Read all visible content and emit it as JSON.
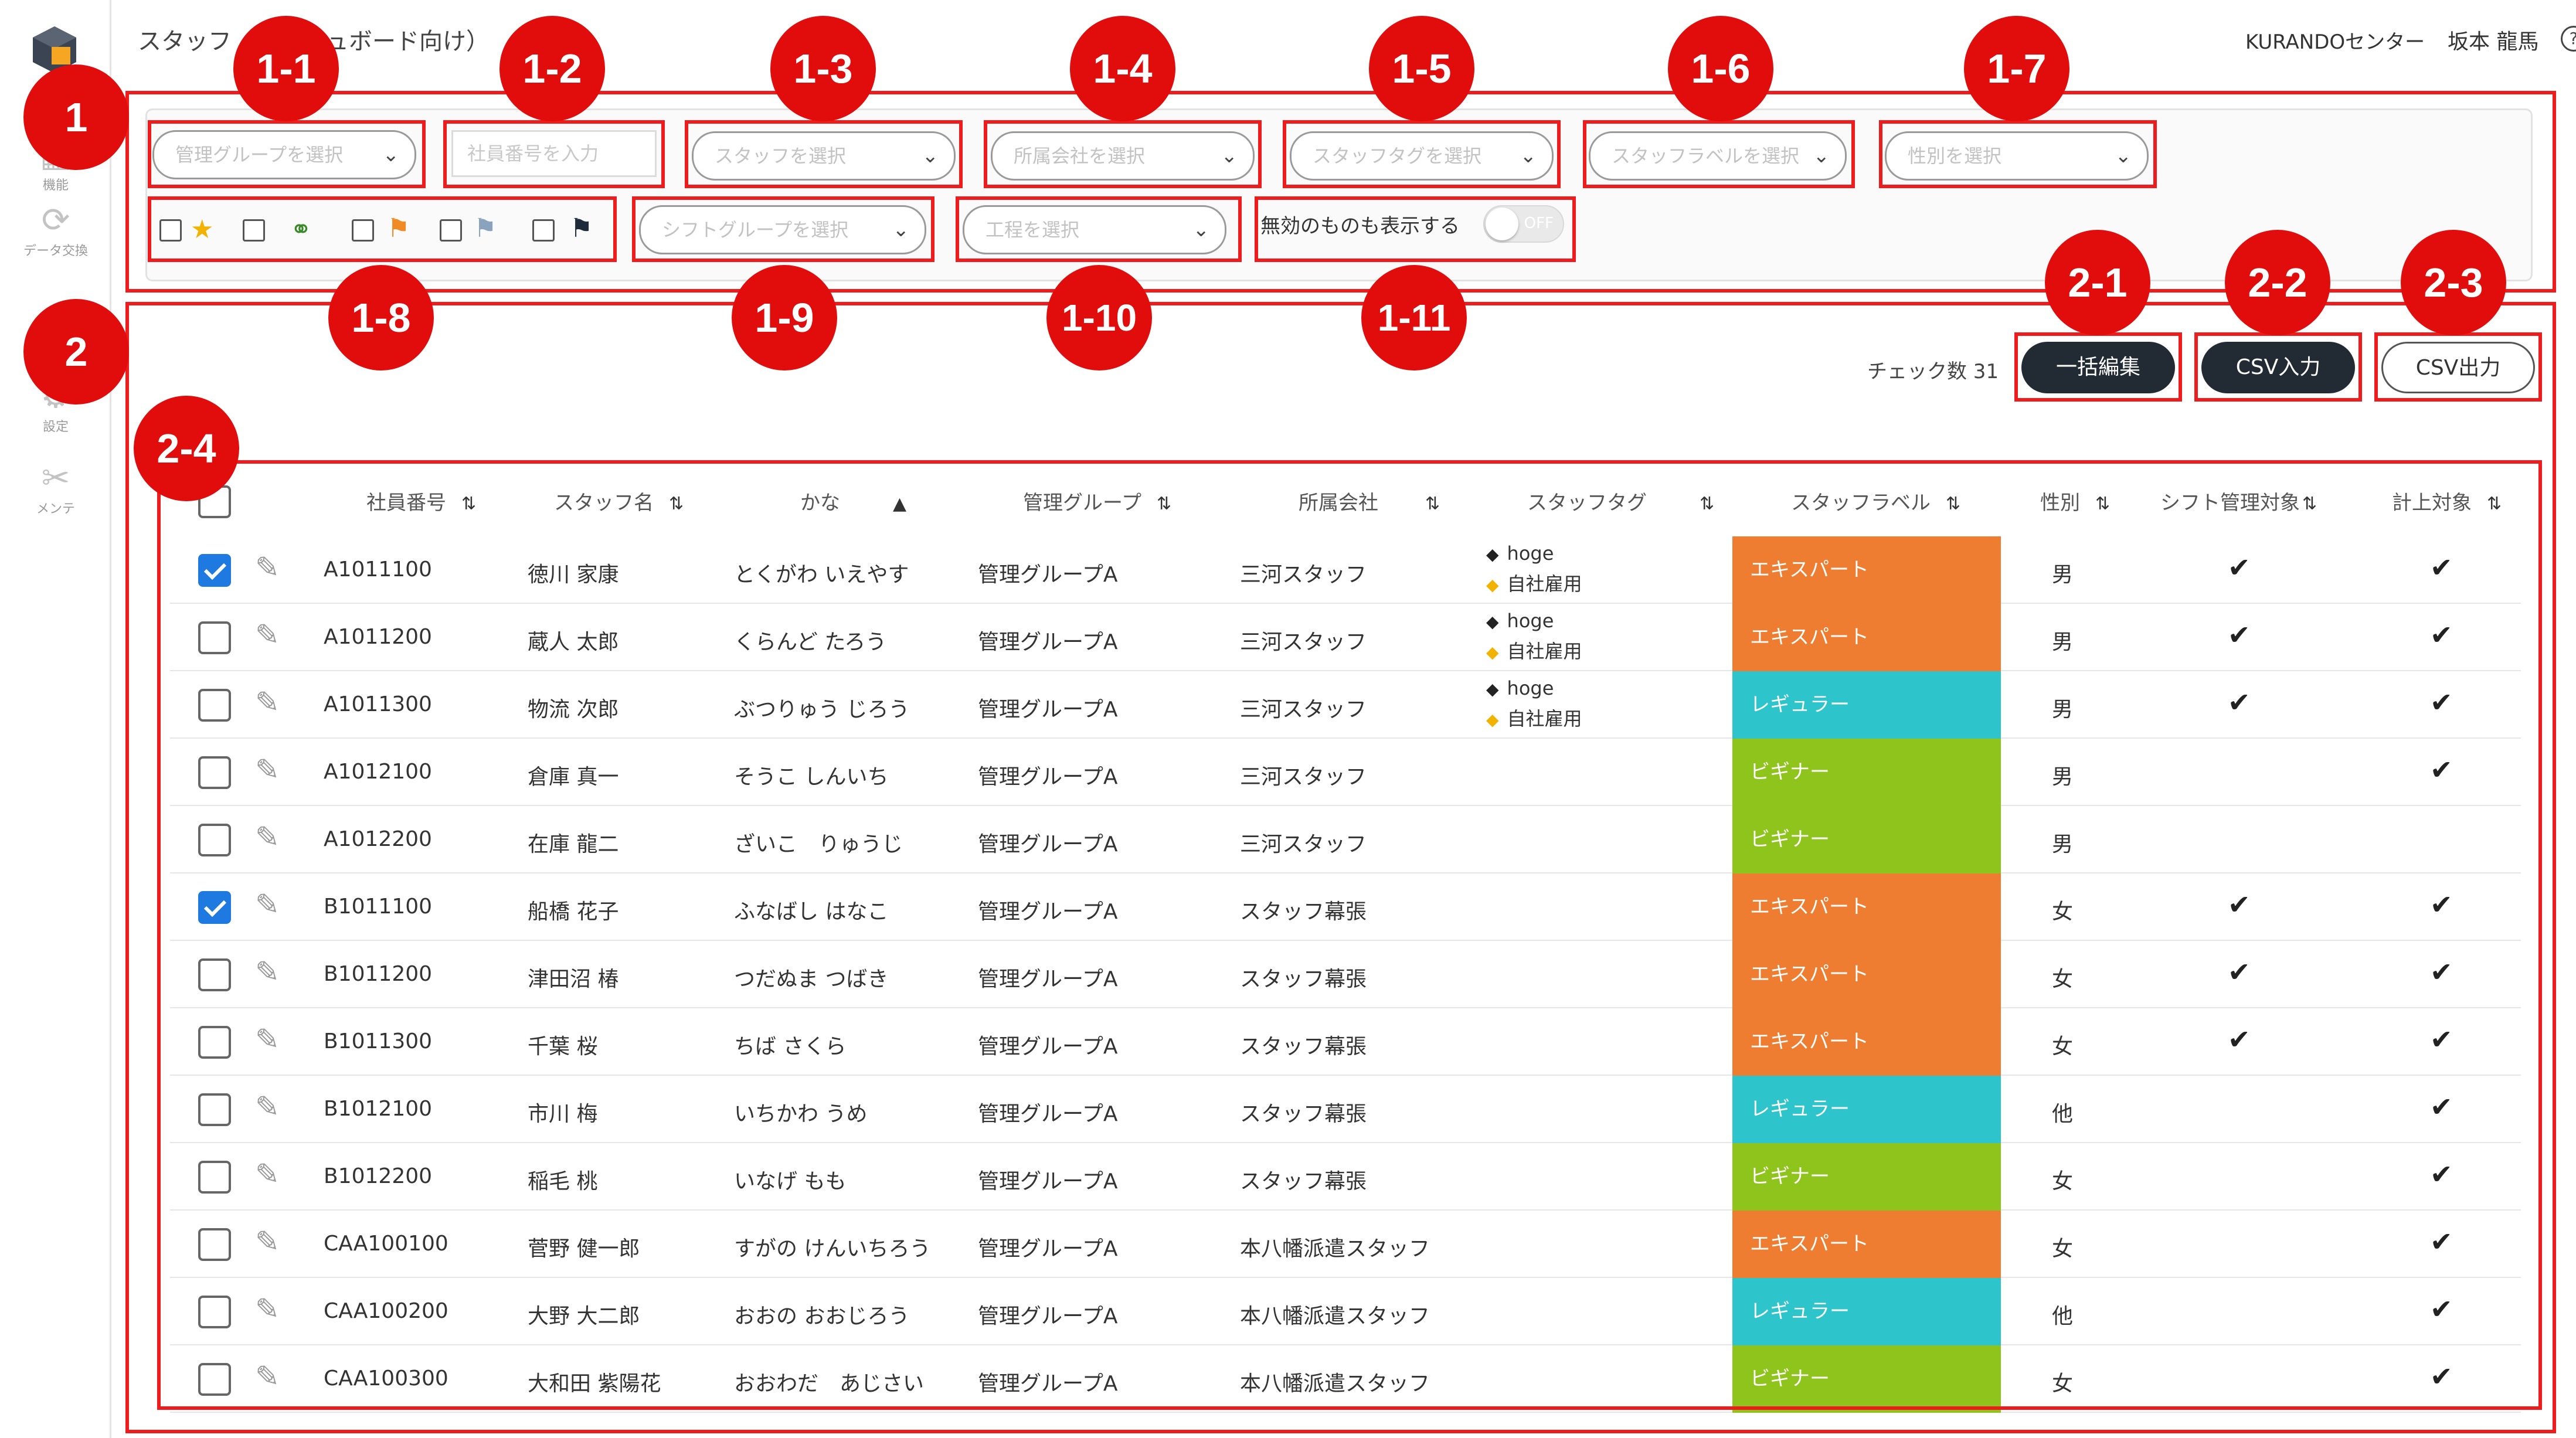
{
  "header": {
    "title": "スタッフ（ダッシュボード向け）",
    "center_name": "KURANDOセンター",
    "user_name": "坂本 龍馬",
    "help_icon": "help-circle-icon",
    "logout_icon": "logout-icon"
  },
  "sidebar": {
    "logo_icon": "cube-logo-icon",
    "items": [
      {
        "label": "機能",
        "icon": "grid-icon"
      },
      {
        "label": "データ交換",
        "icon": "sync-icon"
      },
      {
        "label": "設定",
        "icon": "gear-icon"
      },
      {
        "label": "メンテ",
        "icon": "tools-icon"
      }
    ]
  },
  "filters": {
    "management_group": "管理グループを選択",
    "employee_no": "社員番号を入力",
    "staff": "スタッフを選択",
    "company": "所属会社を選択",
    "staff_tag": "スタッフタグを選択",
    "staff_label": "スタッフラベルを選択",
    "gender": "性別を選択",
    "shift_group": "シフトグループを選択",
    "process": "工程を選択",
    "show_invalid": "無効のものも表示する",
    "toggle_state": "OFF",
    "flag_icons": [
      {
        "icon": "star-icon",
        "color": "#f2b200"
      },
      {
        "icon": "people-icon",
        "color": "#3a8a2a"
      },
      {
        "icon": "flag-icon",
        "color": "#f08a24"
      },
      {
        "icon": "flag-icon",
        "color": "#8aa3bd"
      },
      {
        "icon": "flag-icon",
        "color": "#1c2a3a"
      }
    ]
  },
  "actions": {
    "check_count": "チェック数 31",
    "bulk_edit": "一括編集",
    "csv_import": "CSV入力",
    "csv_export": "CSV出力"
  },
  "table": {
    "columns": [
      "社員番号",
      "スタッフ名",
      "かな",
      "管理グループ",
      "所属会社",
      "スタッフタグ",
      "スタッフラベル",
      "性別",
      "シフト管理対象",
      "計上対象"
    ],
    "label_colors": {
      "エキスパート": "#ee7d31",
      "レギュラー": "#2dc4cc",
      "ビギナー": "#8ec41c"
    },
    "rows": [
      {
        "checked": true,
        "id": "A1011100",
        "name": "徳川 家康",
        "kana": "とくがわ いえやす",
        "group": "管理グループA",
        "company": "三河スタッフ",
        "tags": [
          "hoge",
          "自社雇用"
        ],
        "label": "エキスパート",
        "gender": "男",
        "shift": "✔",
        "count": "✔"
      },
      {
        "checked": false,
        "id": "A1011200",
        "name": "蔵人 太郎",
        "kana": "くらんど たろう",
        "group": "管理グループA",
        "company": "三河スタッフ",
        "tags": [
          "hoge",
          "自社雇用"
        ],
        "label": "エキスパート",
        "gender": "男",
        "shift": "✔",
        "count": "✔"
      },
      {
        "checked": false,
        "id": "A1011300",
        "name": "物流 次郎",
        "kana": "ぶつりゅう じろう",
        "group": "管理グループA",
        "company": "三河スタッフ",
        "tags": [
          "hoge",
          "自社雇用"
        ],
        "label": "レギュラー",
        "gender": "男",
        "shift": "✔",
        "count": "✔"
      },
      {
        "checked": false,
        "id": "A1012100",
        "name": "倉庫 真一",
        "kana": "そうこ しんいち",
        "group": "管理グループA",
        "company": "三河スタッフ",
        "tags": [],
        "label": "ビギナー",
        "gender": "男",
        "shift": "",
        "count": "✔"
      },
      {
        "checked": false,
        "id": "A1012200",
        "name": "在庫 龍二",
        "kana": "ざいこ　りゅうじ",
        "group": "管理グループA",
        "company": "三河スタッフ",
        "tags": [],
        "label": "ビギナー",
        "gender": "男",
        "shift": "",
        "count": ""
      },
      {
        "checked": true,
        "id": "B1011100",
        "name": "船橋 花子",
        "kana": "ふなばし はなこ",
        "group": "管理グループA",
        "company": "スタッフ幕張",
        "tags": [],
        "label": "エキスパート",
        "gender": "女",
        "shift": "✔",
        "count": "✔"
      },
      {
        "checked": false,
        "id": "B1011200",
        "name": "津田沼 椿",
        "kana": "つだぬま つばき",
        "group": "管理グループA",
        "company": "スタッフ幕張",
        "tags": [],
        "label": "エキスパート",
        "gender": "女",
        "shift": "✔",
        "count": "✔"
      },
      {
        "checked": false,
        "id": "B1011300",
        "name": "千葉 桜",
        "kana": "ちば さくら",
        "group": "管理グループA",
        "company": "スタッフ幕張",
        "tags": [],
        "label": "エキスパート",
        "gender": "女",
        "shift": "✔",
        "count": "✔"
      },
      {
        "checked": false,
        "id": "B1012100",
        "name": "市川 梅",
        "kana": "いちかわ うめ",
        "group": "管理グループA",
        "company": "スタッフ幕張",
        "tags": [],
        "label": "レギュラー",
        "gender": "他",
        "shift": "",
        "count": "✔"
      },
      {
        "checked": false,
        "id": "B1012200",
        "name": "稲毛 桃",
        "kana": "いなげ もも",
        "group": "管理グループA",
        "company": "スタッフ幕張",
        "tags": [],
        "label": "ビギナー",
        "gender": "女",
        "shift": "",
        "count": "✔"
      },
      {
        "checked": false,
        "id": "CAA100100",
        "name": "菅野 健一郎",
        "kana": "すがの けんいちろう",
        "group": "管理グループA",
        "company": "本八幡派遣スタッフ",
        "tags": [],
        "label": "エキスパート",
        "gender": "女",
        "shift": "",
        "count": "✔"
      },
      {
        "checked": false,
        "id": "CAA100200",
        "name": "大野 大二郎",
        "kana": "おおの おおじろう",
        "group": "管理グループA",
        "company": "本八幡派遣スタッフ",
        "tags": [],
        "label": "レギュラー",
        "gender": "他",
        "shift": "",
        "count": "✔"
      },
      {
        "checked": false,
        "id": "CAA100300",
        "name": "大和田 紫陽花",
        "kana": "おおわだ　あじさい",
        "group": "管理グループA",
        "company": "本八幡派遣スタッフ",
        "tags": [],
        "label": "ビギナー",
        "gender": "女",
        "shift": "",
        "count": "✔"
      }
    ]
  },
  "annotations": {
    "b1": "1",
    "b1_1": "1-1",
    "b1_2": "1-2",
    "b1_3": "1-3",
    "b1_4": "1-4",
    "b1_5": "1-5",
    "b1_6": "1-6",
    "b1_7": "1-7",
    "b1_8": "1-8",
    "b1_9": "1-9",
    "b1_10": "1-10",
    "b1_11": "1-11",
    "b2": "2",
    "b2_1": "2-1",
    "b2_2": "2-2",
    "b2_3": "2-3",
    "b2_4": "2-4",
    "color": "#e10c0c"
  }
}
